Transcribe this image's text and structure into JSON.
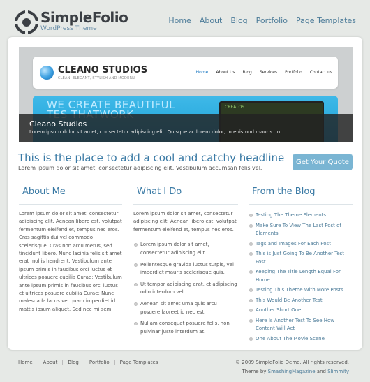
{
  "header": {
    "logo_title": "SimpleFolio",
    "logo_subtitle": "WordPress Theme",
    "nav": [
      "Home",
      "About",
      "Blog",
      "Portfolio",
      "Page Templates"
    ]
  },
  "hero": {
    "mock_brand": "CLEANO STUDIOS",
    "mock_tagline": "CLEAN, ELEGANT, STYLISH AND MODERN",
    "mock_nav": [
      "Home",
      "About Us",
      "Blog",
      "Services",
      "Portfolio",
      "Contact us"
    ],
    "mock_banner_text": "WE CREATE BEAUTIFUL\nTES THATWORK",
    "mock_screen_text": "CREATOS",
    "caption_title": "Cleano Studios",
    "caption_desc": "Lorem ipsum dolor sit amet, consectetur adipiscing elit. Quisque ac lorem dolor, in euismod mauris. In..."
  },
  "headline": {
    "title": "This is the place to add a cool and catchy headline",
    "subtitle": "Lorem ipsum dolor sit amet, consectetur adipiscing elit. Vestibulum accumsan felis vel.",
    "button": "Get Your Quote"
  },
  "about": {
    "heading": "About Me",
    "text": "Lorem ipsum dolor sit amet, consectetur adipiscing elit. Aenean libero est, volutpat fermentum eleifend et, tempus nec eros. Cras sagittis dui vel commodo scelerisque. Cras non arcu metus, sed tincidunt libero. Nunc lacinia felis sit amet erat mollis hendrerit. Vestibulum ante ipsum primis in faucibus orci luctus et ultrices posuere cubilia Curae; Vestibulum ante ipsum primis in faucibus orci luctus et ultrices posuere cubilia Curae; Nunc malesuada lacus vel quam imperdiet id mattis ipsum aliquet. Sed nec mi sem."
  },
  "whatido": {
    "heading": "What I Do",
    "text": "Lorem ipsum dolor sit amet, consectetur adipiscing elit. Aenean libero est, volutpat fermentum eleifend et, tempus nec eros.",
    "bullets": [
      "Lorem ipsum dolor sit amet, consectetur adipiscing elit.",
      "Pellentesque gravida luctus turpis, vel imperdiet mauris scelerisque quis.",
      "Ut tempor adipiscing erat, et adipiscing odio interdum vel.",
      "Aenean sit amet urna quis arcu posuere laoreet id nec est.",
      "Nullam consequat posuere felis, non pulvinar justo interdum at."
    ]
  },
  "blog": {
    "heading": "From the Blog",
    "items": [
      "Testing The Theme Elements",
      "Make Sure To View The Last Post of Elements",
      "Tags and Images For Each Post",
      "This is Just Going To Be Another Test Post",
      "Keeping The Title Length Equal For Home",
      "Testing This Theme With More Posts",
      "This Would Be Another Test",
      "Another Short One",
      "Here Is Another Test To See How Content Will Act",
      "One About The Movie Scene"
    ]
  },
  "footer": {
    "nav": [
      "Home",
      "About",
      "Blog",
      "Portfolio",
      "Page Templates"
    ],
    "copyright": "© 2009 SimpleFolio Demo. All rights reserved.",
    "credit_prefix": "Theme by",
    "credit_link1": "SmashingMagazine",
    "credit_and": "and",
    "credit_link2": "Slimmity"
  }
}
